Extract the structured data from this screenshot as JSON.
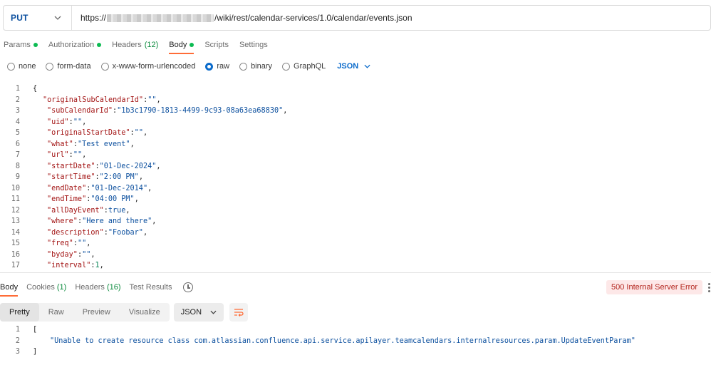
{
  "request": {
    "method": "PUT",
    "url_prefix": "https://",
    "url_suffix": "/wiki/rest/calendar-services/1.0/calendar/events.json"
  },
  "request_tabs": [
    {
      "label": "Params",
      "dot": true
    },
    {
      "label": "Authorization",
      "dot": true
    },
    {
      "label": "Headers",
      "count": "(12)"
    },
    {
      "label": "Body",
      "dot": true,
      "active": true
    },
    {
      "label": "Scripts"
    },
    {
      "label": "Settings"
    }
  ],
  "body_options": {
    "items": [
      "none",
      "form-data",
      "x-www-form-urlencoded",
      "raw",
      "binary",
      "GraphQL"
    ],
    "selected": "raw",
    "format": "JSON"
  },
  "request_body": [
    {
      "n": "1",
      "text": "{"
    },
    {
      "n": "2",
      "key": "\"originalSubCalendarId\"",
      "val": "\"\"",
      "end": ",",
      "indent": 1
    },
    {
      "n": "3",
      "key": "\"subCalendarId\"",
      "val": "\"1b3c1790-1813-4499-9c93-08a63ea68830\"",
      "end": ",",
      "indent": 2
    },
    {
      "n": "4",
      "key": "\"uid\"",
      "val": "\"\"",
      "end": ",",
      "indent": 2
    },
    {
      "n": "5",
      "key": "\"originalStartDate\"",
      "val": "\"\"",
      "end": ",",
      "indent": 2
    },
    {
      "n": "6",
      "key": "\"what\"",
      "val": "\"Test event\"",
      "end": ",",
      "indent": 2
    },
    {
      "n": "7",
      "key": "\"url\"",
      "val": "\"\"",
      "end": ",",
      "indent": 2
    },
    {
      "n": "8",
      "key": "\"startDate\"",
      "val": "\"01-Dec-2024\"",
      "end": ",",
      "indent": 2
    },
    {
      "n": "9",
      "key": "\"startTime\"",
      "val": "\"2:00 PM\"",
      "end": ",",
      "indent": 2
    },
    {
      "n": "10",
      "key": "\"endDate\"",
      "val": "\"01-Dec-2014\"",
      "end": ",",
      "indent": 2
    },
    {
      "n": "11",
      "key": "\"endTime\"",
      "val": "\"04:00 PM\"",
      "end": ",",
      "indent": 2
    },
    {
      "n": "12",
      "key": "\"allDayEvent\"",
      "val": "true",
      "end": ",",
      "indent": 2,
      "bool": true
    },
    {
      "n": "13",
      "key": "\"where\"",
      "val": "\"Here and there\"",
      "end": ",",
      "indent": 2
    },
    {
      "n": "14",
      "key": "\"description\"",
      "val": "\"Foobar\"",
      "end": ",",
      "indent": 2
    },
    {
      "n": "15",
      "key": "\"freq\"",
      "val": "\"\"",
      "end": ",",
      "indent": 2
    },
    {
      "n": "16",
      "key": "\"byday\"",
      "val": "\"\"",
      "end": ",",
      "indent": 2
    },
    {
      "n": "17",
      "key": "\"interval\"",
      "val": "1",
      "end": ",",
      "indent": 2,
      "num": true
    }
  ],
  "response_tabs": [
    {
      "label": "Body",
      "active": true
    },
    {
      "label": "Cookies",
      "count": "(1)"
    },
    {
      "label": "Headers",
      "count": "(16)"
    },
    {
      "label": "Test Results"
    }
  ],
  "status": "500 Internal Server Error",
  "view_modes": [
    "Pretty",
    "Raw",
    "Preview",
    "Visualize"
  ],
  "view_selected": "Pretty",
  "response_format": "JSON",
  "response_body": [
    {
      "n": "1",
      "text": "["
    },
    {
      "n": "2",
      "text": "\"Unable to create resource class com.atlassian.confluence.api.service.apilayer.teamcalendars.internalresources.param.UpdateEventParam\"",
      "indent": 1
    },
    {
      "n": "3",
      "text": "]"
    }
  ],
  "colors": {
    "accent": "#ff6c37",
    "link": "#0b6bcb",
    "error_bg": "#fde8e8",
    "error_text": "#b3261e",
    "ok_dot": "#0cbb52"
  }
}
